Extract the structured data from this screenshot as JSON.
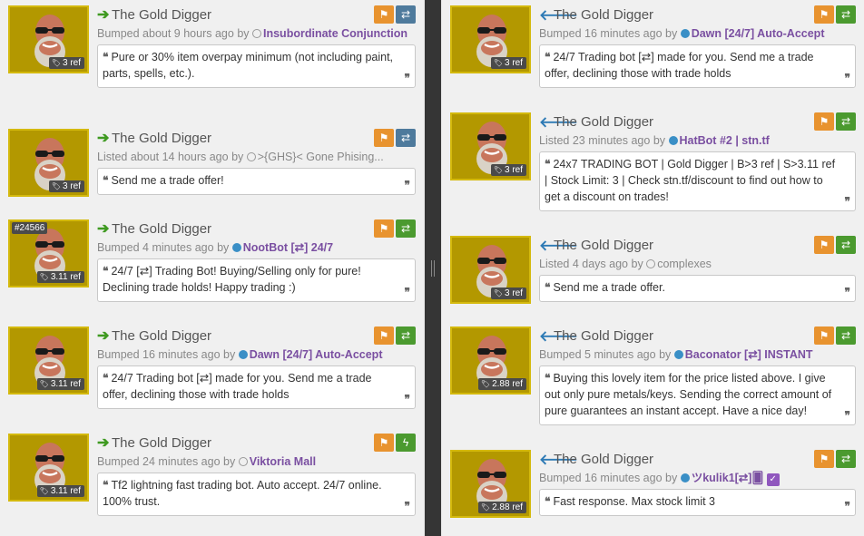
{
  "item_name": "The Gold Digger",
  "colors": {
    "item_border": "#d4b90d",
    "item_bg": "#b39800",
    "buy_arrow": "#3f9a21",
    "sell_arrow": "#2d7ab5",
    "report_button": "#e8932f",
    "user_link": "#7a4fa1"
  },
  "quote_open": "❝",
  "quote_close": "❞",
  "left_listings": [
    {
      "intent": "buy",
      "arrow": "➔",
      "ref": "3 ref",
      "verb": "Bumped",
      "time": "about 9 hours ago",
      "user": "Insubordinate Conjunction",
      "user_status": "offline",
      "comment": "Pure or 30% item overpay minimum (not including paint, parts, spells, etc.).",
      "trade_icon": "⇄",
      "trade_style": "blue"
    },
    {
      "intent": "buy",
      "arrow": "➔",
      "ref": "3 ref",
      "verb": "Listed",
      "time": "about 14 hours ago",
      "user": ">{GHS}< Gone Phising...",
      "user_status": "offline",
      "comment": "Send me a trade offer!",
      "trade_icon": "⇄",
      "trade_style": "blue"
    },
    {
      "intent": "buy",
      "arrow": "➔",
      "ref": "3.11 ref",
      "craft": "#24566",
      "verb": "Bumped",
      "time": "4 minutes ago",
      "user": "NootBot [⇄] 24/7",
      "user_status": "online",
      "comment": "24/7 [⇄] Trading Bot! Buying/Selling only for pure! Declining trade holds! Happy trading :)",
      "trade_icon": "⇄",
      "trade_style": "green"
    },
    {
      "intent": "buy",
      "arrow": "➔",
      "ref": "3.11 ref",
      "verb": "Bumped",
      "time": "16 minutes ago",
      "user": "Dawn [24/7] Auto-Accept",
      "user_status": "online",
      "comment": "24/7 Trading bot [⇄] made for you. Send me a trade offer, declining those with trade holds",
      "trade_icon": "⇄",
      "trade_style": "green"
    },
    {
      "intent": "buy",
      "arrow": "➔",
      "ref": "3.11 ref",
      "verb": "Bumped",
      "time": "24 minutes ago",
      "user": "Viktoria Mall",
      "user_status": "offline",
      "comment": "Tf2 lightning fast trading bot. Auto accept. 24/7 online. 100% trust.",
      "trade_icon": "ϟ",
      "trade_style": "lightning"
    }
  ],
  "right_listings": [
    {
      "intent": "sell",
      "arrow": "🡐",
      "ref": "3 ref",
      "verb": "Bumped",
      "time": "16 minutes ago",
      "user": "Dawn [24/7] Auto-Accept",
      "user_status": "online",
      "comment": "24/7 Trading bot [⇄] made for you. Send me a trade offer, declining those with trade holds",
      "trade_icon": "⇄",
      "trade_style": "green"
    },
    {
      "intent": "sell",
      "arrow": "🡐",
      "ref": "3 ref",
      "verb": "Listed",
      "time": "23 minutes ago",
      "user": "HatBot #2 | stn.tf",
      "user_status": "online",
      "comment": "24x7 TRADING BOT | Gold Digger | B>3 ref | S>3.11 ref | Stock Limit: 3 | Check stn.tf/discount to find out how to get a discount on trades!",
      "trade_icon": "⇄",
      "trade_style": "green"
    },
    {
      "intent": "sell",
      "arrow": "🡐",
      "ref": "3 ref",
      "verb": "Listed",
      "time": "4 days ago",
      "user": "complexes",
      "user_status": "offline",
      "comment": "Send me a trade offer.",
      "trade_icon": "⇄",
      "trade_style": "green"
    },
    {
      "intent": "sell",
      "arrow": "🡐",
      "ref": "2.88 ref",
      "verb": "Bumped",
      "time": "5 minutes ago",
      "user": "Baconator [⇄] INSTANT",
      "user_status": "online",
      "comment": "Buying this lovely item for the price listed above. I give out only pure metals/keys. Sending the correct amount of pure guarantees an instant accept. Have a nice day!",
      "trade_icon": "⇄",
      "trade_style": "green"
    },
    {
      "intent": "sell",
      "arrow": "🡐",
      "ref": "2.88 ref",
      "verb": "Bumped",
      "time": "16 minutes ago",
      "user": "ツkulik1[⇄]🂠",
      "user_status": "online",
      "verified": "✓",
      "comment": "Fast response. Max stock limit 3",
      "trade_icon": "⇄",
      "trade_style": "green"
    }
  ],
  "labels": {
    "by": "by",
    "report_icon": "⚑"
  }
}
